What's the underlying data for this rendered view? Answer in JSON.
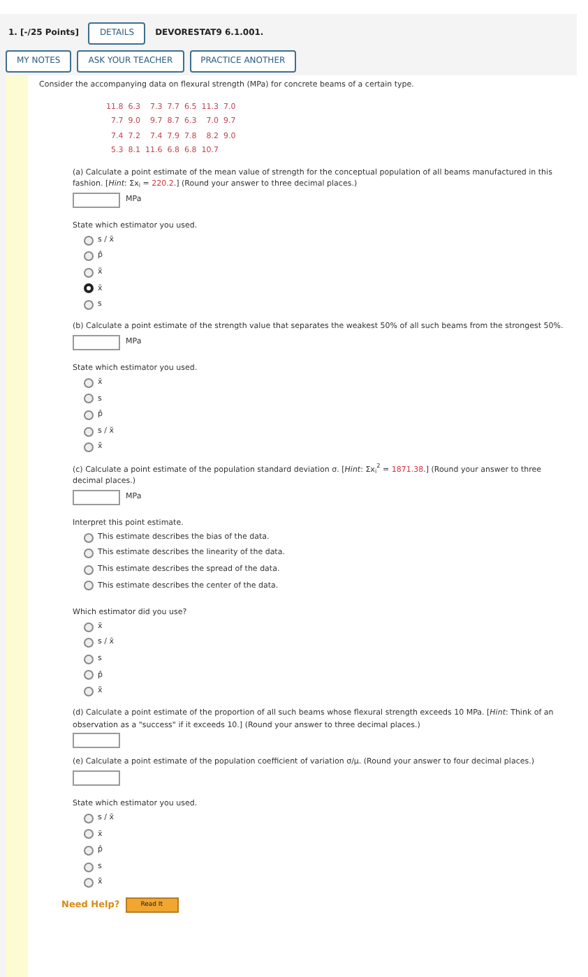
{
  "question": {
    "number": "1.",
    "points": "[-/25 Points]",
    "details_button": "DETAILS",
    "code": "DEVORESTAT9 6.1.001."
  },
  "actions": [
    "MY NOTES",
    "ASK YOUR TEACHER",
    "PRACTICE ANOTHER"
  ],
  "intro": "Consider the accompanying data on flexural strength (MPa) for concrete beams of a certain type.",
  "data_rows": [
    "11.8  6.3    7.3  7.7  6.5  11.3  7.0",
    "  7.7  9.0    9.7  8.7  6.3    7.0  9.7",
    "  7.4  7.2    7.4  7.9  7.8    8.2  9.0",
    "  5.3  8.1  11.6  6.8  6.8  10.7"
  ],
  "parts": [
    {
      "kind": "answer",
      "segments": [
        {
          "kind": "text",
          "text": "(a) Calculate a point estimate of the mean value of strength for the conceptual population of all beams manufactured in this fashion. [*Hint*: Σx$_{i}$ = "
        },
        {
          "kind": "value",
          "text": "220.2"
        },
        {
          "kind": "text",
          "text": ".] (Round your answer to three decimal places.)"
        }
      ],
      "unit": "MPa"
    },
    {
      "kind": "choice",
      "label": "State which estimator you used.",
      "options": [
        {
          "label": "s / x̄",
          "selected": false
        },
        {
          "label": "p̂",
          "selected": false
        },
        {
          "label": "x̃",
          "selected": false
        },
        {
          "label": "x̄",
          "selected": true
        },
        {
          "label": "s",
          "selected": false
        }
      ]
    },
    {
      "kind": "answer",
      "segments": [
        {
          "kind": "text",
          "text": "(b) Calculate a point estimate of the strength value that separates the weakest 50% of all such beams from the strongest 50%."
        }
      ],
      "unit": "MPa"
    },
    {
      "kind": "choice",
      "label": "State which estimator you used.",
      "options": [
        {
          "label": "x̄",
          "selected": false
        },
        {
          "label": "s",
          "selected": false
        },
        {
          "label": "p̂",
          "selected": false
        },
        {
          "label": "s / x̄",
          "selected": false
        },
        {
          "label": "x̃",
          "selected": false
        }
      ]
    },
    {
      "kind": "answer",
      "segments": [
        {
          "kind": "text",
          "text": "(c) Calculate a point estimate of the population standard deviation σ. [*Hint*: Σx$_{i}$$^{2}$ = "
        },
        {
          "kind": "value",
          "text": "1871.38"
        },
        {
          "kind": "text",
          "text": ".] (Round your answer to three decimal places.)"
        }
      ],
      "unit": "MPa"
    },
    {
      "kind": "choice",
      "label": "Interpret this point estimate.",
      "options": [
        {
          "label": "This estimate describes the bias of the data.",
          "selected": false
        },
        {
          "label": "This estimate describes the linearity of the data.",
          "selected": false
        },
        {
          "label": "This estimate describes the spread of the data.",
          "selected": false
        },
        {
          "label": "This estimate describes the center of the data.",
          "selected": false
        }
      ]
    },
    {
      "kind": "choice",
      "label": "Which estimator did you use?",
      "options": [
        {
          "label": "x̄",
          "selected": false
        },
        {
          "label": "s / x̄",
          "selected": false
        },
        {
          "label": "s",
          "selected": false
        },
        {
          "label": "p̂",
          "selected": false
        },
        {
          "label": "x̃",
          "selected": false
        }
      ]
    },
    {
      "kind": "answer",
      "segments": [
        {
          "kind": "text",
          "text": "(d) Calculate a point estimate of the proportion of all such beams whose flexural strength exceeds 10 MPa. [*Hint*: Think of an observation as a \"success\" if it exceeds 10.] (Round your answer to three decimal places.)"
        }
      ]
    },
    {
      "kind": "answer",
      "segments": [
        {
          "kind": "text",
          "text": "(e) Calculate a point estimate of the population coefficient of variation σ/μ. (Round your answer to four decimal places.)"
        }
      ]
    },
    {
      "kind": "choice",
      "label": "State which estimator you used.",
      "options": [
        {
          "label": "s / x̄",
          "selected": false
        },
        {
          "label": "x̄",
          "selected": false
        },
        {
          "label": "p̂",
          "selected": false
        },
        {
          "label": "s",
          "selected": false
        },
        {
          "label": "x̃",
          "selected": false
        }
      ]
    }
  ],
  "help": {
    "label": "Need Help?",
    "button": "Read It"
  }
}
